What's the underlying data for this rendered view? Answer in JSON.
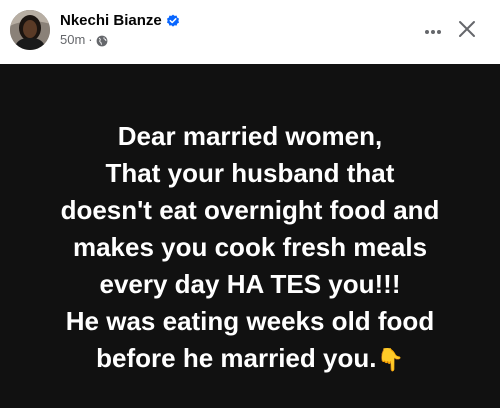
{
  "post": {
    "author": {
      "name": "Nkechi Bianze",
      "verified_icon": "verified-badge-icon"
    },
    "time": "50m",
    "separator": "·",
    "audience_icon": "globe-icon",
    "actions": {
      "more_icon": "more-horizontal-icon",
      "close_icon": "close-icon"
    },
    "body": {
      "background_color": "#111111",
      "text_color": "#ffffff",
      "lines": [
        "Dear married women,",
        "That your husband that",
        "doesn't eat overnight food and",
        "makes you cook fresh meals",
        "every day HA TES you!!!",
        "He was eating weeks old food",
        "before he married you."
      ],
      "emoji": "👇"
    }
  },
  "colors": {
    "verified_blue": "#0866ff",
    "secondary_text": "#65676b",
    "primary_text": "#050505"
  }
}
